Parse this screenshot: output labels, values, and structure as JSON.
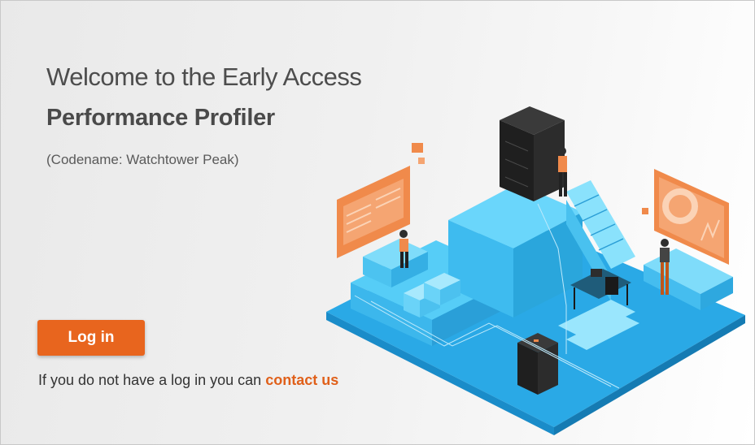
{
  "welcome": {
    "title": "Welcome to the Early Access",
    "product_name": "Performance Profiler",
    "codename": "(Codename: Watchtower Peak)"
  },
  "auth": {
    "login_label": "Log in",
    "contact_prefix": "If you do not have a log in you can",
    "contact_link_label": "contact us"
  },
  "illustration": {
    "icon": "isometric-datacenter-illustration"
  },
  "colors": {
    "accent": "#e8651e",
    "platform_blue": "#2fb4ec",
    "panel_orange": "#f08a4b",
    "title_text": "#4d4d4d"
  }
}
